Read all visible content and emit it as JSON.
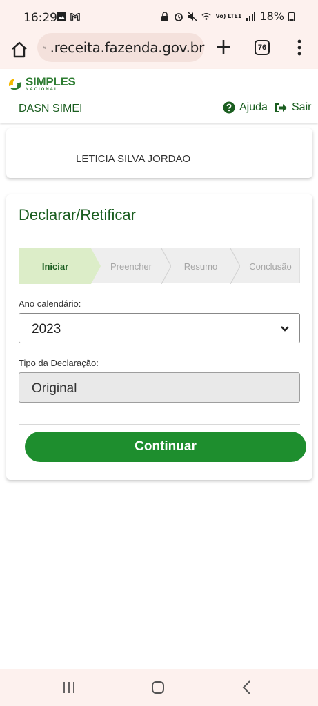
{
  "status_bar": {
    "time": "16:29",
    "battery": "18%",
    "signal_label": "Vo) LTE1",
    "icons": [
      "image-icon",
      "gmail-icon",
      "lock-icon",
      "alarm-icon",
      "mute-icon",
      "wifi-icon",
      "signal-icon",
      "battery-icon"
    ]
  },
  "browser": {
    "url": ".receita.fazenda.gov.br",
    "tab_count": "76",
    "icons": [
      "home-icon",
      "site-settings-icon",
      "plus-icon",
      "tabs-icon",
      "more-vert-icon"
    ]
  },
  "header": {
    "logo_title": "SIMPLES",
    "logo_sub": "NACIONAL",
    "app_name": "DASN SIMEI",
    "help_label": "Ajuda",
    "logout_label": "Sair"
  },
  "user": {
    "name": "LETICIA SILVA JORDAO"
  },
  "form": {
    "title": "Declarar/Retificar",
    "steps": [
      {
        "label": "Iniciar",
        "active": true
      },
      {
        "label": "Preencher",
        "active": false
      },
      {
        "label": "Resumo",
        "active": false
      },
      {
        "label": "Conclusão",
        "active": false
      }
    ],
    "year_label": "Ano calendário:",
    "year_value": "2023",
    "type_label": "Tipo da Declaração:",
    "type_value": "Original",
    "continue_label": "Continuar"
  },
  "colors": {
    "brand_green": "#1e8e2e",
    "dark_green": "#1b5e20",
    "active_step": "#dcedc8",
    "chrome_bg": "#fdf1ee"
  }
}
